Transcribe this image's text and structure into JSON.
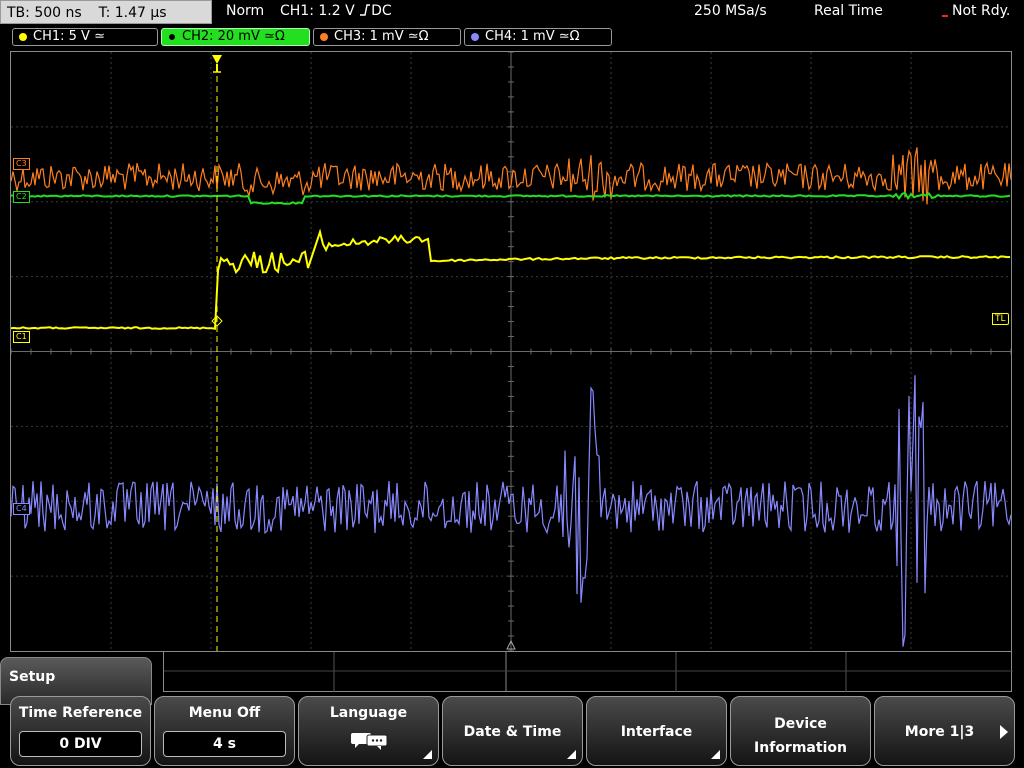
{
  "topbar": {
    "timebase": "TB: 500 ns",
    "trigger_time": "T: 1.47 µs",
    "trigger_mode": "Norm",
    "trigger_source": "CH1: 1.2 V",
    "trigger_coupling": "DC",
    "sample_rate": "250 MSa/s",
    "acq_mode": "Real Time",
    "status": "Not Rdy."
  },
  "channels": [
    {
      "label": "CH1: 5 V",
      "color": "#ffff00"
    },
    {
      "label": "CH2: 20 mV",
      "color": "#22e020"
    },
    {
      "label": "CH3: 1 mV",
      "color": "#ff8020"
    },
    {
      "label": "CH4: 1 mV",
      "color": "#8888ff"
    }
  ],
  "markers": {
    "ch1": "C1",
    "ch2": "C2",
    "ch3": "C3",
    "ch4": "C4",
    "trigger_level": "TL"
  },
  "menu": {
    "title": "Setup",
    "time_reference": {
      "label": "Time Reference",
      "value": "0 DIV"
    },
    "menu_off": {
      "label": "Menu Off",
      "value": "4 s"
    },
    "language": {
      "label": "Language",
      "icon": "speech-bubbles-icon"
    },
    "date_time": {
      "label": "Date & Time"
    },
    "interface": {
      "label": "Interface"
    },
    "device_info": {
      "line1": "Device",
      "line2": "Information"
    },
    "more": {
      "label": "More 1|3"
    }
  }
}
